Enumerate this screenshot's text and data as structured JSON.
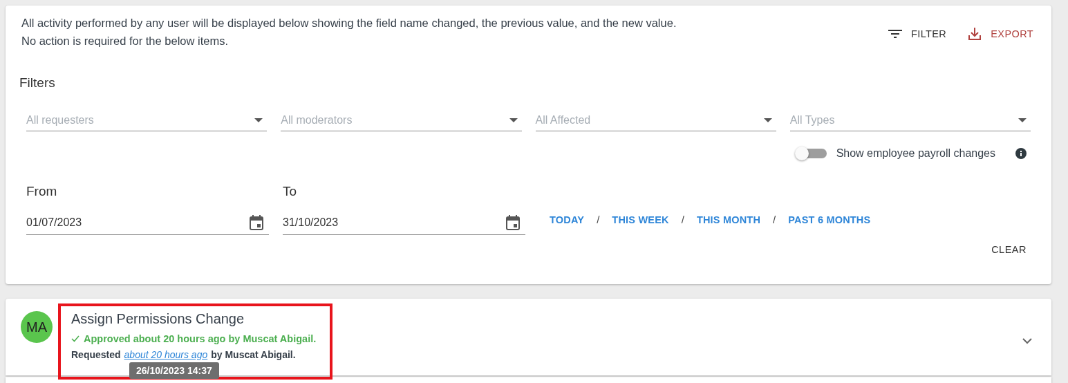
{
  "intro": [
    "All activity performed by any user will be displayed below showing the field name changed, the previous value, and the new value.",
    "No action is required for the below items."
  ],
  "actions": [
    {
      "kind": "filter",
      "label": "FILTER"
    },
    {
      "kind": "export",
      "label": "EXPORT"
    }
  ],
  "filters": {
    "title": "Filters",
    "dropdowns": [
      {
        "placeholder": "All requesters"
      },
      {
        "placeholder": "All moderators"
      },
      {
        "placeholder": "All Affected"
      },
      {
        "placeholder": "All Types"
      }
    ],
    "payroll_toggle": {
      "label": "Show employee payroll changes",
      "on": false
    },
    "dates": [
      {
        "label": "From",
        "value": "01/07/2023"
      },
      {
        "label": "To",
        "value": "31/10/2023"
      }
    ],
    "quick_ranges": [
      "TODAY",
      "THIS WEEK",
      "THIS MONTH",
      "PAST 6 MONTHS"
    ],
    "separator": "/",
    "clear": "CLEAR"
  },
  "activity": [
    {
      "initials": "MA",
      "title": "Assign Permissions Change",
      "status": "Approved about 20 hours ago by Muscat Abigail.",
      "requested_label": "Requested",
      "requested_time": "about 20 hours ago",
      "requested_by": "by Muscat Abigail.",
      "tooltip": "26/10/2023 14:37",
      "highlighted": true,
      "expanded": false
    }
  ]
}
